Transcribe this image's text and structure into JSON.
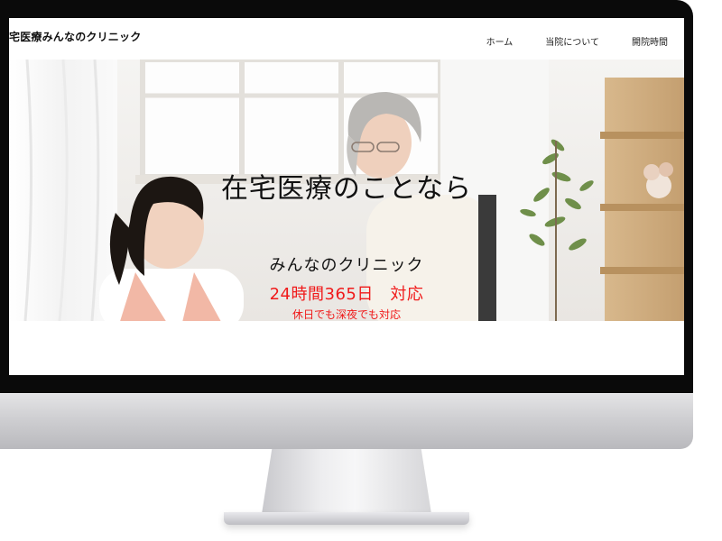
{
  "site": {
    "logo_text": "宅医療みんなのクリニック",
    "nav": [
      {
        "label": "ホーム"
      },
      {
        "label": "当院について"
      },
      {
        "label": "開院時間"
      }
    ]
  },
  "hero": {
    "headline": "在宅医療のことなら",
    "subheadline": "みんなのクリニック",
    "hours": "24時間365日　対応",
    "note": "休日でも深夜でも対応",
    "image_description_icon": "photo-caregiver-and-elderly-woman",
    "colors": {
      "headline": "#111111",
      "accent_red": "#f01a1a"
    }
  },
  "device": {
    "type": "desktop-monitor-mockup",
    "colors": {
      "bezel": "#0a0a0a",
      "chin": "#cfcfd2"
    }
  }
}
